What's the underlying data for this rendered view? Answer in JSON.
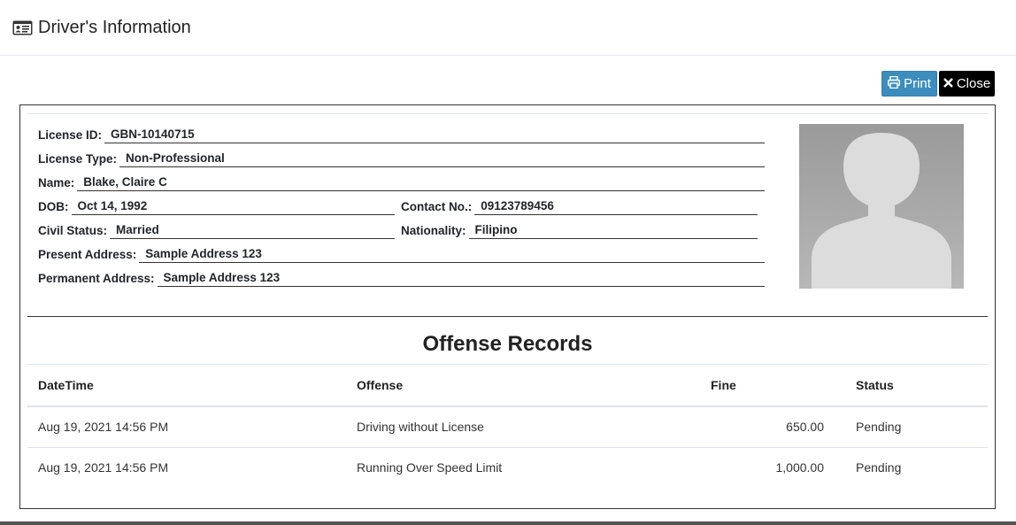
{
  "modal": {
    "title": "Driver's Information",
    "title_icon": "id-card-icon"
  },
  "buttons": {
    "print_label": "Print",
    "close_label": "Close"
  },
  "driver": {
    "license_id": {
      "label": "License ID:",
      "value": "GBN-10140715"
    },
    "license_type": {
      "label": "License Type:",
      "value": "Non-Professional"
    },
    "name": {
      "label": "Name:",
      "value": "Blake, Claire C"
    },
    "dob": {
      "label": "DOB:",
      "value": "Oct 14, 1992"
    },
    "contact": {
      "label": "Contact No.:",
      "value": "09123789456"
    },
    "civil_status": {
      "label": "Civil Status:",
      "value": "Married"
    },
    "nationality": {
      "label": "Nationality:",
      "value": "Filipino"
    },
    "present_address": {
      "label": "Present Address:",
      "value": "Sample Address 123"
    },
    "permanent_address": {
      "label": "Permanent Address:",
      "value": "Sample Address 123"
    }
  },
  "offenses": {
    "title": "Offense Records",
    "columns": [
      "DateTime",
      "Offense",
      "Fine",
      "Status"
    ],
    "rows": [
      {
        "datetime": "Aug 19, 2021 14:56 PM",
        "offense": "Driving without License",
        "fine": "650.00",
        "status": "Pending"
      },
      {
        "datetime": "Aug 19, 2021 14:56 PM",
        "offense": "Running Over Speed Limit",
        "fine": "1,000.00",
        "status": "Pending"
      }
    ]
  },
  "colors": {
    "print_button": "#3c8dbc",
    "close_button": "#000000"
  }
}
